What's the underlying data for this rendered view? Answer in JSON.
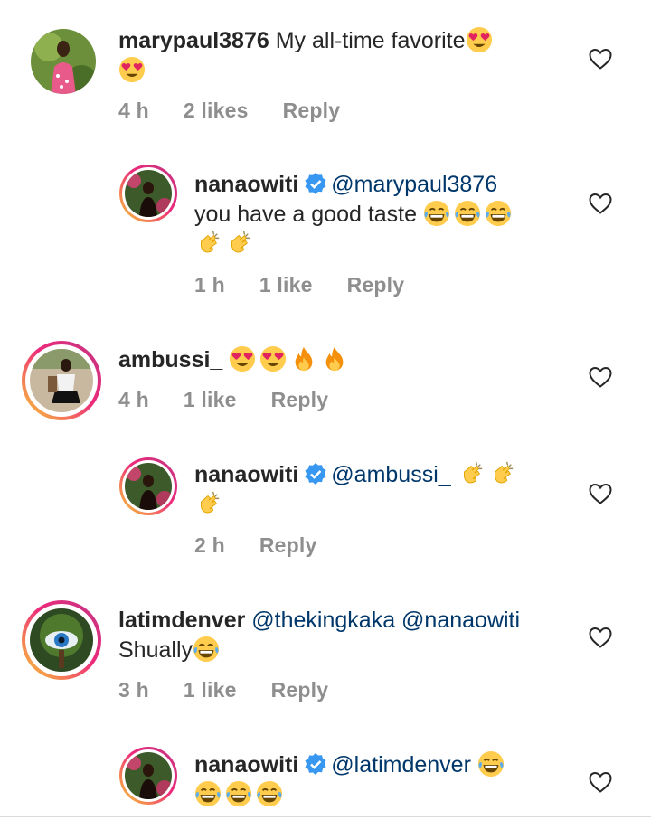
{
  "comments": [
    {
      "username": "marypaul3876",
      "mention": "",
      "text": " My all-time favorite",
      "text2": "",
      "time": "4 h",
      "likes": "2 likes",
      "reply": "Reply",
      "emojis": [
        "heart-eyes",
        "heart-eyes"
      ]
    },
    {
      "username": "nanaowiti",
      "mention": "@marypaul3876",
      "text": "you have a good taste",
      "time": "1 h",
      "likes": "1 like",
      "reply": "Reply",
      "emojis": [
        "grin-tears",
        "grin-tears",
        "grin-tears",
        "clap",
        "clap"
      ]
    },
    {
      "username": "ambussi_",
      "mention": "",
      "text": "",
      "time": "4 h",
      "likes": "1 like",
      "reply": "Reply",
      "emojis": [
        "heart-eyes",
        "heart-eyes",
        "fire",
        "fire"
      ]
    },
    {
      "username": "nanaowiti",
      "mention": "@ambussi_",
      "text": "",
      "time": "2 h",
      "likes": "",
      "reply": "Reply",
      "emojis": [
        "clap",
        "clap",
        "clap"
      ]
    },
    {
      "username": "latimdenver",
      "mention": "@thekingkaka @nanaowiti",
      "text": "Shually",
      "time": "3 h",
      "likes": "1 like",
      "reply": "Reply",
      "emojis": [
        "grin-tears"
      ]
    },
    {
      "username": "nanaowiti",
      "mention": "@latimdenver",
      "text": "",
      "time": "",
      "likes": "",
      "reply": "",
      "emojis": [
        "grin-tears",
        "grin-tears",
        "grin-tears",
        "grin-tears"
      ]
    }
  ],
  "colors": {
    "text": "#262626",
    "meta": "#8e8e8e",
    "mention": "#00376b",
    "verified": "#3897f0",
    "story_ring_start": "#f9ce34",
    "story_ring_end": "#c13584"
  }
}
